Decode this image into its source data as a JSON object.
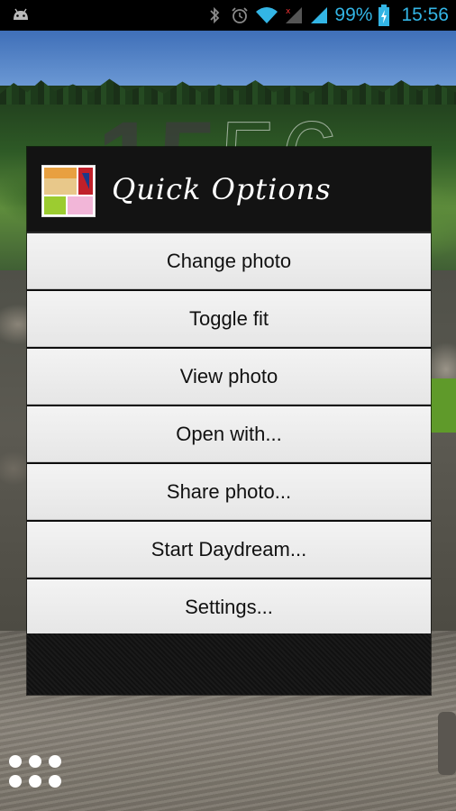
{
  "status_bar": {
    "battery_percent": "99%",
    "time": "15:56",
    "icons": [
      "android-icon",
      "bluetooth-icon",
      "alarm-icon",
      "wifi-icon",
      "signal-no-data-icon",
      "signal-icon",
      "battery-charging-icon"
    ],
    "accent_color": "#33b5e5"
  },
  "wallpaper_clock": {
    "hours": "15",
    "minutes": "56"
  },
  "dialog": {
    "title": "Quick Options",
    "icon": "app-photo-icon",
    "options": [
      {
        "label": "Change photo"
      },
      {
        "label": "Toggle fit"
      },
      {
        "label": "View photo"
      },
      {
        "label": "Open with..."
      },
      {
        "label": "Share photo..."
      },
      {
        "label": "Start Daydream..."
      },
      {
        "label": "Settings..."
      }
    ]
  },
  "launcher": {
    "drawer_icon": "app-drawer-icon"
  }
}
